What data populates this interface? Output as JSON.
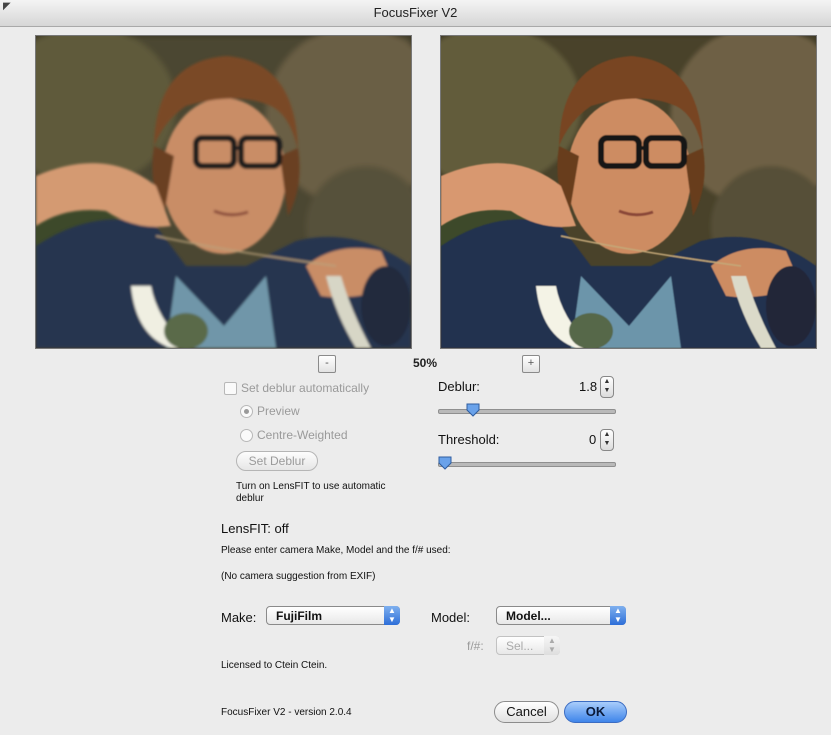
{
  "window": {
    "title": "FocusFixer V2"
  },
  "preview": {
    "zoom": "50%",
    "zoom_out": "-",
    "zoom_in": "+"
  },
  "auto": {
    "set_auto_label": "Set deblur automatically",
    "preview_label": "Preview",
    "centre_label": "Centre-Weighted",
    "set_deblur_button": "Set Deblur",
    "hint": "Turn on LensFIT to use automatic deblur"
  },
  "deblur": {
    "label": "Deblur:",
    "value": "1.8",
    "level": 0.17
  },
  "threshold": {
    "label": "Threshold:",
    "value": "0",
    "level": 0.0
  },
  "lensfit": {
    "status": "LensFIT: off",
    "instruction": "Please enter camera Make, Model and the f/# used:",
    "exif_note": "(No camera suggestion from EXIF)"
  },
  "camera": {
    "make_label": "Make:",
    "make_value": "FujiFilm",
    "model_label": "Model:",
    "model_value": "Model...",
    "f_label": "f/#:",
    "f_value": "Sel..."
  },
  "license": "Licensed to Ctein Ctein.",
  "version": "FocusFixer V2 - version 2.0.4",
  "buttons": {
    "cancel": "Cancel",
    "ok": "OK"
  },
  "colors": {
    "accent": "#3f85ea",
    "disabled_text": "#9a9a9a"
  },
  "icons": {
    "stepper": "up-down-stepper-icon",
    "popup_arrow": "popup-arrows-icon",
    "slider_thumb": "slider-thumb-icon"
  }
}
